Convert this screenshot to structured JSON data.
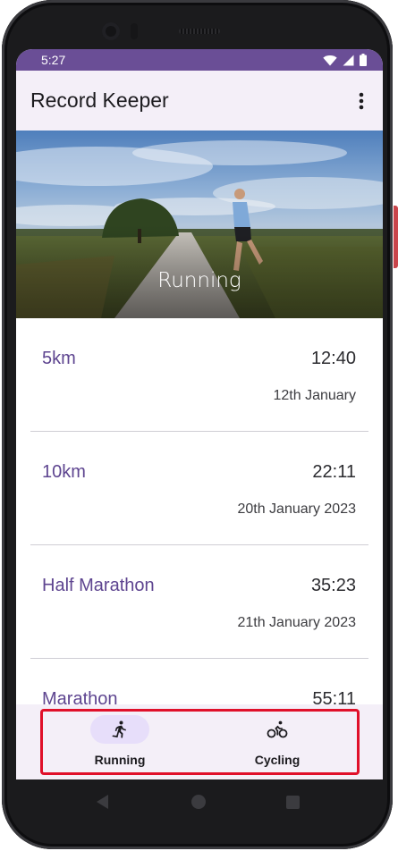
{
  "status_bar": {
    "time": "5:27",
    "icons": [
      "wifi-icon",
      "signal-icon",
      "battery-icon"
    ],
    "color": "#6a4e96"
  },
  "app_bar": {
    "title": "Record Keeper",
    "menu_icon": "more-vert-icon"
  },
  "hero": {
    "title": "Running"
  },
  "records": [
    {
      "name": "5km",
      "time": "12:40",
      "date": "12th January"
    },
    {
      "name": "10km",
      "time": "22:11",
      "date": "20th January 2023"
    },
    {
      "name": "Half Marathon",
      "time": "35:23",
      "date": "21th January 2023"
    },
    {
      "name": "Marathon",
      "time": "55:11",
      "date": ""
    }
  ],
  "bottom_nav": {
    "items": [
      {
        "label": "Running",
        "icon": "running-icon",
        "selected": true
      },
      {
        "label": "Cycling",
        "icon": "bike-icon",
        "selected": false
      }
    ],
    "accent": "#e7defa"
  },
  "system_nav": {
    "icons": [
      "back-icon",
      "home-icon",
      "recents-icon"
    ]
  }
}
